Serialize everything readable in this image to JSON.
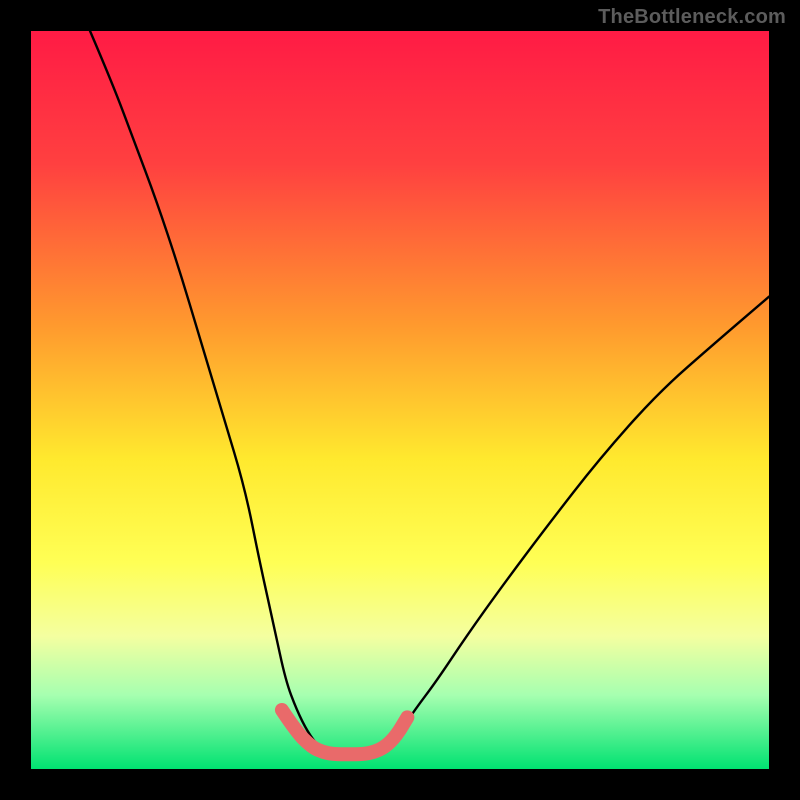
{
  "branding": "TheBottleneck.com",
  "chart_data": {
    "type": "line",
    "title": "",
    "xlabel": "",
    "ylabel": "",
    "xlim": [
      0,
      100
    ],
    "ylim": [
      0,
      100
    ],
    "grid": false,
    "legend": false,
    "background_gradient": {
      "stops": [
        {
          "pos": 0.0,
          "color": "#ff1b45"
        },
        {
          "pos": 0.18,
          "color": "#ff4040"
        },
        {
          "pos": 0.4,
          "color": "#ff9a2e"
        },
        {
          "pos": 0.58,
          "color": "#ffe92e"
        },
        {
          "pos": 0.72,
          "color": "#ffff55"
        },
        {
          "pos": 0.82,
          "color": "#f4ffa0"
        },
        {
          "pos": 0.9,
          "color": "#a6ffb0"
        },
        {
          "pos": 1.0,
          "color": "#00e271"
        }
      ]
    },
    "series": [
      {
        "name": "curve-left",
        "color": "#000000",
        "x": [
          8,
          11,
          14,
          17,
          20,
          23,
          26,
          29,
          31,
          33,
          34.5,
          36,
          37.5,
          39
        ],
        "y": [
          100,
          93,
          85,
          77,
          68,
          58,
          48,
          38,
          28,
          19,
          12,
          8,
          5,
          3
        ]
      },
      {
        "name": "curve-right",
        "color": "#000000",
        "x": [
          48,
          50,
          52,
          55,
          59,
          64,
          70,
          77,
          85,
          93,
          100
        ],
        "y": [
          3,
          5,
          8,
          12,
          18,
          25,
          33,
          42,
          51,
          58,
          64
        ]
      },
      {
        "name": "base-highlight",
        "color": "#e96a6a",
        "x": [
          34,
          36,
          38,
          39.5,
          41,
          43,
          45,
          46.5,
          48,
          49.5,
          51
        ],
        "y": [
          8,
          5,
          3,
          2.3,
          2,
          2,
          2,
          2.3,
          3,
          4.5,
          7
        ]
      }
    ]
  }
}
